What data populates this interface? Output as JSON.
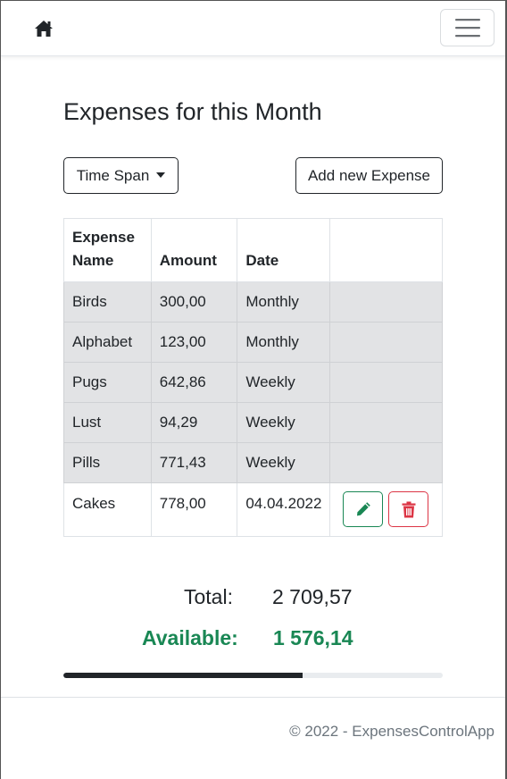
{
  "nav": {
    "home_icon": "home-icon",
    "menu_icon": "hamburger-menu-icon"
  },
  "page": {
    "title": "Expenses for this Month"
  },
  "toolbar": {
    "time_span_label": "Time Span",
    "add_expense_label": "Add new Expense"
  },
  "table": {
    "headers": [
      "Expense Name",
      "Amount",
      "Date",
      ""
    ],
    "rows": [
      {
        "name": "Birds",
        "amount": "300,00",
        "date": "Monthly"
      },
      {
        "name": "Alphabet",
        "amount": "123,00",
        "date": "Monthly"
      },
      {
        "name": "Pugs",
        "amount": "642,86",
        "date": "Weekly"
      },
      {
        "name": "Lust",
        "amount": "94,29",
        "date": "Weekly"
      },
      {
        "name": "Pills",
        "amount": "771,43",
        "date": "Weekly"
      },
      {
        "name": "Cakes",
        "amount": "778,00",
        "date": "04.04.2022"
      }
    ],
    "edit_icon": "pencil-icon",
    "delete_icon": "trash-icon"
  },
  "summary": {
    "total_label": "Total:",
    "total_value": "2 709,57",
    "available_label": "Available:",
    "available_value": "1 576,14",
    "progress_fraction": 0.63
  },
  "colors": {
    "success": "#198754",
    "danger": "#dc3545",
    "dark": "#212529",
    "row_shade": "#e2e3e5"
  },
  "footer": {
    "text": "© 2022 - ExpensesControlApp"
  }
}
